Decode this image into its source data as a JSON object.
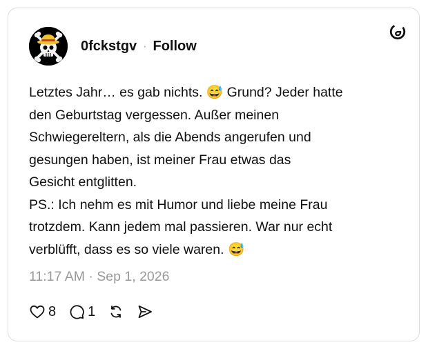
{
  "post": {
    "username": "0fckstgv",
    "separator": "·",
    "follow_label": "Follow",
    "text": "Letztes Jahr… es gab nichts. 😅 Grund? Jeder hatte\nden Geburtstag vergessen. Außer meinen\nSchwiegereltern, als die Abends angerufen und\ngesungen haben, ist meiner Frau etwas das\nGesicht entglitten.\nPS.: Ich nehm es mit Humor und liebe meine Frau\ntrotzdem. Kann jedem mal passieren. War nur echt\nverblüfft, dass es so viele waren. 😅",
    "timestamp": "11:17 AM · Sep 1, 2026"
  },
  "actions": {
    "like_count": "8",
    "reply_count": "1"
  },
  "icons": {
    "avatar": "straw-hat-skull-icon",
    "brand": "threads-logo-icon",
    "like": "heart-icon",
    "reply": "speech-bubble-icon",
    "repost": "repost-icon",
    "share": "send-icon"
  }
}
